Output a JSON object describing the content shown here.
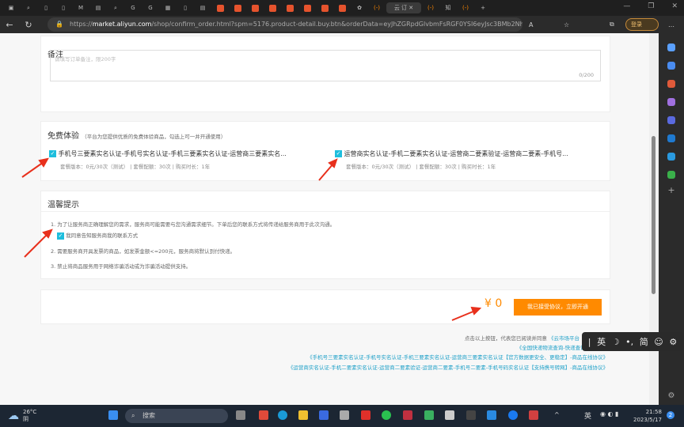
{
  "browser": {
    "url_host": "market.aliyun.com",
    "url_prefix": "https://",
    "url_rest": "/shop/confirm_order.html?spm=5176.product-detail.buy.btn&orderData=eyJhZGRpdGlvbmFsRGF0YSI6eyJsc3BMb2Nhd...",
    "login_label": "登录",
    "active_tab_label": "云 订"
  },
  "remark": {
    "title": "备注",
    "placeholder": "请填写订单备注，限200字",
    "counter": "0/200"
  },
  "trial": {
    "title": "免费体验",
    "subtitle": "（平台为您提供优质的免费体验商品，勾选上可一并开通使用）",
    "items": [
      {
        "name": "手机号三要素实名认证-手机号实名认证-手机三要素实名认证-运营商三要素实名...",
        "meta": "套餐版本：0元/30次（测试） | 套餐配额：30次 | 购买时长：1年",
        "checked": true
      },
      {
        "name": "运营商实名认证-手机二要素实名认证-运营商二要素验证-运营商二要素-手机号...",
        "meta": "套餐版本：0元/30次（测试） | 套餐配额：30次 | 购买时长：1年",
        "checked": true
      }
    ]
  },
  "tips": {
    "title": "温馨提示",
    "line1": "1. 为了让服务商正确理解您的需求，服务商可能需要与您沟通需求细节。下单后您的联系方式将传递给服务商用于此次沟通。",
    "consent": "我同意告知服务商我的联系方式",
    "consent_checked": true,
    "line2": "2. 需要服务商开具发票的商品，如发票金额<=200元，服务商将默认到付快递。",
    "line3": "3. 禁止将商品服务用于网络诈骗活动或为诈骗活动提供支持。"
  },
  "checkout": {
    "price": "¥ 0",
    "button": "我已接受协议，立即开通"
  },
  "agreements": {
    "intro": "点击以上按钮，代表您已阅读并同意",
    "links": [
      "《云市场平台",
      "《全国快递物流查询-快递查询接口-商品",
      "《手机号三要素实名认证-手机号实名认证-手机三要素实名认证-运营商三要素实名认证【官方数据更安全、更稳定】-商品在线协议》",
      "《运营商实名认证-手机二要素实名认证-运营商二要素验证-运营商二要素-手机号二要素-手机号码实名认证【支持携号转网】-商品在线协议》"
    ]
  },
  "ime": {
    "lang": "英",
    "mode": "简"
  },
  "taskbar": {
    "weather_temp": "26°C",
    "weather_desc": "阴",
    "search": "搜索",
    "tray_lang": "英",
    "time": "21:58",
    "date": "2023/5/17",
    "notif": "2"
  },
  "colors": {
    "accent": "#ff8a00",
    "checkbox": "#1ebedd",
    "link": "#1ea0c8",
    "arrow": "#e8301c"
  }
}
